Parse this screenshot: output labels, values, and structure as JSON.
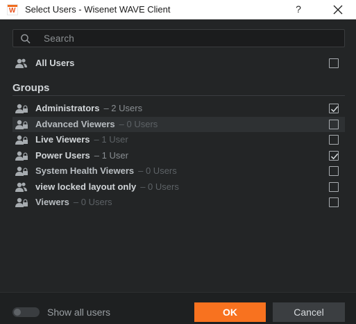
{
  "window": {
    "title": "Select Users - Wisenet WAVE Client",
    "logo_letter": "W",
    "help_label": "?"
  },
  "search": {
    "placeholder": "Search"
  },
  "all_users": {
    "label": "All Users",
    "checked": false
  },
  "groups": {
    "heading": "Groups",
    "items": [
      {
        "name": "Administrators",
        "count": "– 2 Users",
        "checked": true
      },
      {
        "name": "Advanced Viewers",
        "count": "– 0 Users",
        "checked": false
      },
      {
        "name": "Live Viewers",
        "count": "– 1 User",
        "checked": false
      },
      {
        "name": "Power Users",
        "count": "– 1 User",
        "checked": true
      },
      {
        "name": "System Health Viewers",
        "count": "– 0 Users",
        "checked": false
      },
      {
        "name": "view locked layout only",
        "count": "– 0 Users",
        "checked": false
      },
      {
        "name": "Viewers",
        "count": "– 0 Users",
        "checked": false
      }
    ]
  },
  "footer": {
    "show_all_label": "Show all users",
    "show_all_enabled": false,
    "ok_label": "OK",
    "cancel_label": "Cancel"
  },
  "colors": {
    "background": "#232526",
    "accent": "#f8721f",
    "text": "#d2d6d9",
    "muted": "#8a8f93"
  },
  "icons": {
    "app": "wisenet-logo-icon",
    "search": "search-icon",
    "user_group": "users-icon",
    "close": "close-icon",
    "check": "check-icon"
  }
}
